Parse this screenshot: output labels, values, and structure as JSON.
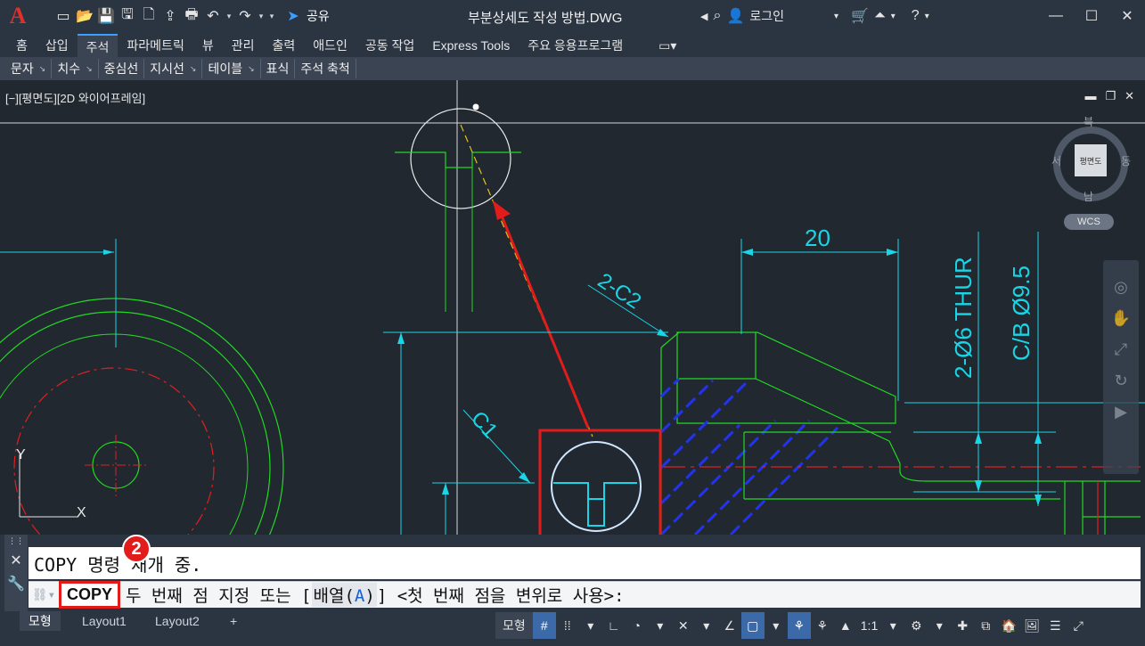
{
  "app": {
    "logo": "A",
    "title": "부분상세도 작성 방법.DWG"
  },
  "share": {
    "label": "공유"
  },
  "user": {
    "login_label": "로그인"
  },
  "ribbon_tabs": [
    "홈",
    "삽입",
    "주석",
    "파라메트릭",
    "뷰",
    "관리",
    "출력",
    "애드인",
    "공동 작업",
    "Express Tools",
    "주요 응용프로그램"
  ],
  "active_tab_index": 2,
  "panels": [
    {
      "label": "문자",
      "has_arrow": true
    },
    {
      "label": "치수",
      "has_arrow": true
    },
    {
      "label": "중심선",
      "has_arrow": false
    },
    {
      "label": "지시선",
      "has_arrow": true
    },
    {
      "label": "테이블",
      "has_arrow": true
    },
    {
      "label": "표식",
      "has_arrow": false
    },
    {
      "label": "주석 축척",
      "has_arrow": false
    }
  ],
  "viewport": {
    "label": "[−][평면도][2D 와이어프레임]",
    "viewcube": {
      "north": "북",
      "south": "남",
      "east": "동",
      "west": "서",
      "face": "평면도",
      "ucs": "WCS"
    },
    "ucs_x": "X",
    "ucs_y": "Y"
  },
  "drawing": {
    "dim_20": "20",
    "c2_label": "2-C2",
    "c1_label": "C1",
    "hole_label": "2-Ø6 THUR",
    "cb_label": "C/B Ø9.5"
  },
  "command": {
    "history": "COPY 명령 재개 중.",
    "name": "COPY",
    "prompt": "두 번째 점 지정 또는 [",
    "option_text": "배열(",
    "option_key": "A",
    "option_close": ")",
    "prompt_end": "] <첫 번째 점을 변위로 사용>:",
    "badge": "2"
  },
  "layout_tabs": [
    "모형",
    "Layout1",
    "Layout2"
  ],
  "status": {
    "model_label": "모형",
    "scale": "1:1"
  },
  "colors": {
    "accent": "#3aa0ff",
    "highlight": "#e21b1b",
    "cad_cyan": "#19d6e6",
    "cad_green": "#22d922",
    "cad_red": "#e02020",
    "bg": "#212830"
  }
}
